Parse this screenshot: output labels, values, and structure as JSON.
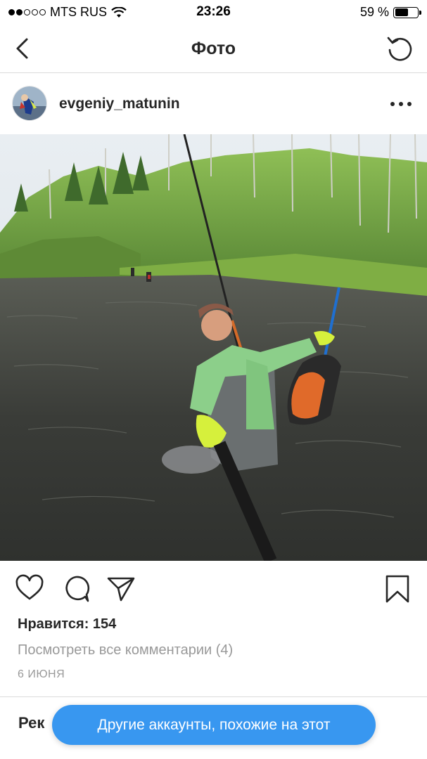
{
  "status_bar": {
    "carrier": "MTS RUS",
    "time": "23:26",
    "battery": "59 %",
    "battery_level": 0.59,
    "signal_bars_filled": 2,
    "signal_bars_total": 5
  },
  "nav": {
    "title": "Фото",
    "back_icon": "chevron-left-icon",
    "refresh_icon": "refresh-icon"
  },
  "post": {
    "username": "evgeniy_matunin",
    "likes": "Нравится: 154",
    "view_comments": "Посмотреть все комментарии (4)",
    "date": "6 ИЮНЯ"
  },
  "actions": {
    "icons": [
      "heart-icon",
      "comment-icon",
      "share-icon",
      "bookmark-icon"
    ]
  },
  "recommendations": {
    "label_partial": "Рек",
    "similar_accounts_button": "Другие аккаунты, похожие на этот"
  },
  "colors": {
    "accent": "#3897f0",
    "text": "#262626",
    "muted": "#999999",
    "divider": "#dbdbdb"
  }
}
